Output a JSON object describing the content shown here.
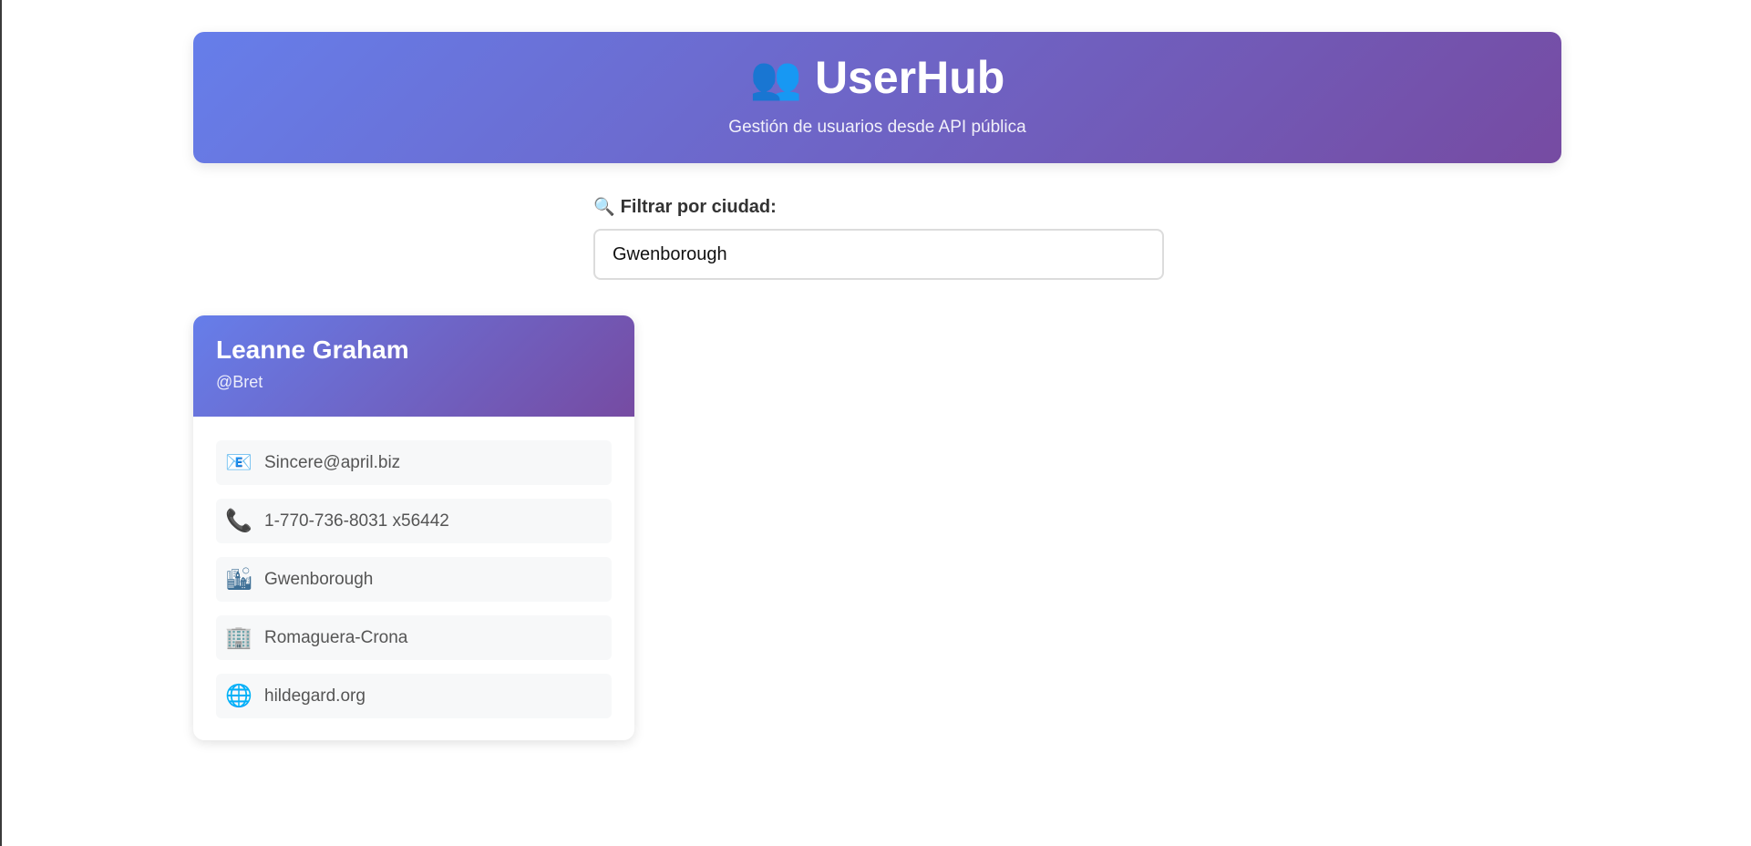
{
  "header": {
    "icon": "users-icon",
    "icon_glyph": "👥",
    "title": "UserHub",
    "subtitle": "Gestión de usuarios desde API pública",
    "gradient": [
      "#667eea",
      "#764ba2"
    ]
  },
  "filter": {
    "icon": "search-icon",
    "icon_glyph": "🔍",
    "label": "Filtrar por ciudad:",
    "value": "Gwenborough"
  },
  "cards": [
    {
      "name": "Leanne Graham",
      "username": "@Bret",
      "details": [
        {
          "icon": "email-icon",
          "glyph": "📧",
          "value": "Sincere@april.biz"
        },
        {
          "icon": "phone-icon",
          "glyph": "📞",
          "value": "1-770-736-8031 x56442"
        },
        {
          "icon": "city-icon",
          "glyph": "🏙",
          "value": "Gwenborough"
        },
        {
          "icon": "building-icon",
          "glyph": "🏢",
          "value": "Romaguera-Crona"
        },
        {
          "icon": "globe-icon",
          "glyph": "🌐",
          "value": "hildegard.org"
        }
      ]
    }
  ]
}
